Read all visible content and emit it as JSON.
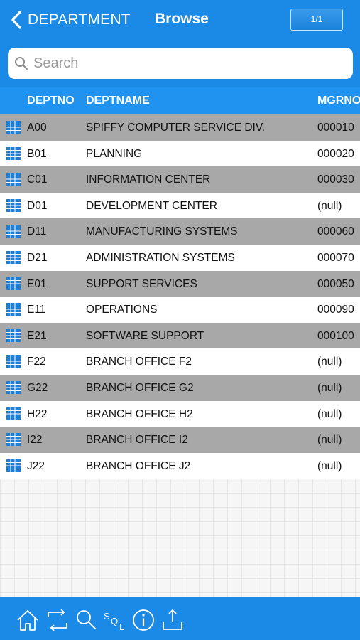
{
  "header": {
    "back_label": "DEPARTMENT",
    "title": "Browse",
    "page_indicator": "1/1"
  },
  "search": {
    "placeholder": "Search",
    "value": ""
  },
  "table": {
    "columns": [
      "DEPTNO",
      "DEPTNAME",
      "MGRNO"
    ],
    "rows": [
      {
        "deptno": "A00",
        "deptname": "SPIFFY COMPUTER SERVICE DIV.",
        "mgrno": "000010"
      },
      {
        "deptno": "B01",
        "deptname": "PLANNING",
        "mgrno": "000020"
      },
      {
        "deptno": "C01",
        "deptname": "INFORMATION CENTER",
        "mgrno": "000030"
      },
      {
        "deptno": "D01",
        "deptname": "DEVELOPMENT CENTER",
        "mgrno": "(null)"
      },
      {
        "deptno": "D11",
        "deptname": "MANUFACTURING SYSTEMS",
        "mgrno": "000060"
      },
      {
        "deptno": "D21",
        "deptname": "ADMINISTRATION SYSTEMS",
        "mgrno": "000070"
      },
      {
        "deptno": "E01",
        "deptname": "SUPPORT SERVICES",
        "mgrno": "000050"
      },
      {
        "deptno": "E11",
        "deptname": "OPERATIONS",
        "mgrno": "000090"
      },
      {
        "deptno": "E21",
        "deptname": "SOFTWARE SUPPORT",
        "mgrno": "000100"
      },
      {
        "deptno": "F22",
        "deptname": "BRANCH OFFICE F2",
        "mgrno": "(null)"
      },
      {
        "deptno": "G22",
        "deptname": "BRANCH OFFICE G2",
        "mgrno": "(null)"
      },
      {
        "deptno": "H22",
        "deptname": "BRANCH OFFICE H2",
        "mgrno": "(null)"
      },
      {
        "deptno": "I22",
        "deptname": "BRANCH OFFICE I2",
        "mgrno": "(null)"
      },
      {
        "deptno": "J22",
        "deptname": "BRANCH OFFICE J2",
        "mgrno": "(null)"
      }
    ]
  },
  "toolbar": {
    "items": [
      {
        "icon": "home-icon"
      },
      {
        "icon": "refresh-icon"
      },
      {
        "icon": "search-icon"
      },
      {
        "icon": "sql-icon",
        "label": "SQL"
      },
      {
        "icon": "info-icon"
      },
      {
        "icon": "export-icon"
      }
    ]
  },
  "colors": {
    "nav_blue": "#1a8ae6",
    "column_header_blue": "#1f93ef",
    "row_odd": "#a8a8a8",
    "row_even": "#ffffff",
    "table_icon": "#1f7fd6"
  }
}
